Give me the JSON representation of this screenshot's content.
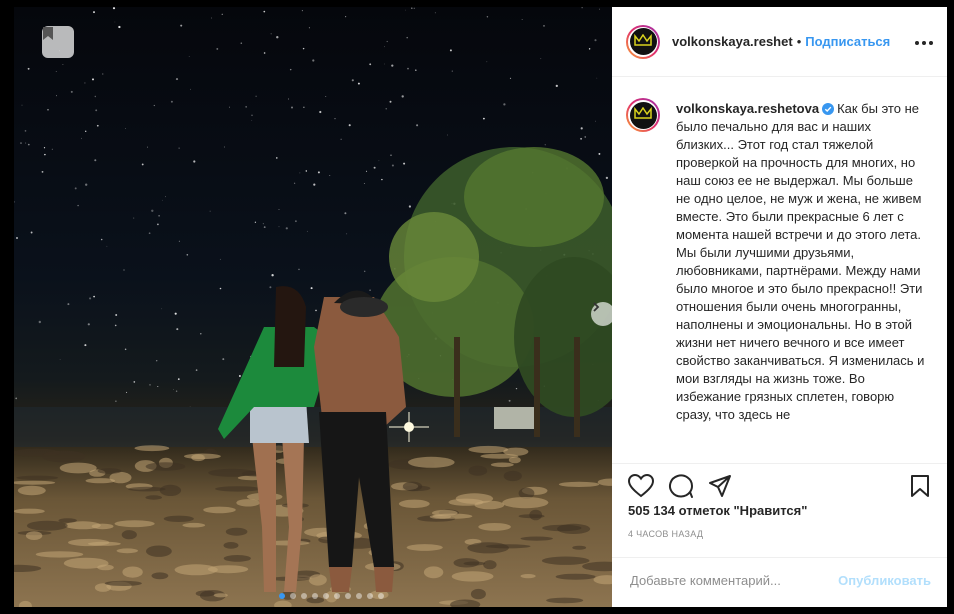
{
  "post": {
    "header_username": "volkonskaya.reshet",
    "separator": "•",
    "follow_label": "Подписаться",
    "caption_username": "volkonskaya.reshetova",
    "caption_text": "Как бы это не было печально для вас и наших близких... Этот год стал тяжелой проверкой на прочность для многих, но наш союз ее не выдержал. Мы больше не одно целое, не муж и жена, не живем вместе. Это были прекрасные 6 лет с момента нашей встречи и до этого лета. Мы были лучшими друзьями, любовниками, партнёрами. Между нами было многое и это было прекрасно!! Эти отношения были очень многогранны, наполнены и эмоциональны. Но в этой жизни нет ничего вечного и все имеет свойство заканчиваться. Я изменилась и мои взгляды на жизнь тоже. Во избежание грязных сплетен, говорю сразу, что здесь не",
    "likes_text": "505 134 отметок \"Нравится\"",
    "time_text": "4 часов назад",
    "carousel_total_dots": 10,
    "carousel_active_index": 0
  },
  "comment": {
    "placeholder": "Добавьте комментарий...",
    "publish_label": "Опубликовать"
  },
  "colors": {
    "accent": "#3897f0",
    "publish_disabled": "#b2dffc",
    "avatar_ring": "#e1306c",
    "crown": "#d9d21e"
  },
  "icons": [
    "bookmark-icon",
    "chevron-right-icon",
    "more-icon",
    "heart-icon",
    "comment-icon",
    "share-icon",
    "save-icon",
    "verified-icon",
    "crown-icon"
  ]
}
